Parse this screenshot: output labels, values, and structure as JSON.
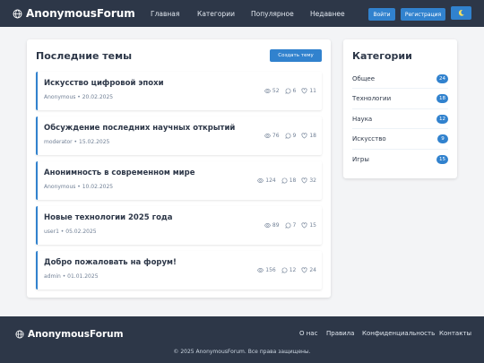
{
  "header": {
    "logo_text": "AnonymousForum",
    "nav": [
      "Главная",
      "Категории",
      "Популярное",
      "Недавнее"
    ],
    "login_label": "Войти",
    "register_label": "Регистрация",
    "theme_icon": "moon-icon"
  },
  "topics": {
    "title": "Последние темы",
    "create_label": "Создать тему",
    "items": [
      {
        "title": "Искусство цифровой эпохи",
        "meta": "Anonymous • 20.02.2025",
        "views": "52",
        "replies": "6",
        "likes": "11"
      },
      {
        "title": "Обсуждение последних научных открытий",
        "meta": "moderator • 15.02.2025",
        "views": "76",
        "replies": "9",
        "likes": "18"
      },
      {
        "title": "Анонимность в современном мире",
        "meta": "Anonymous • 10.02.2025",
        "views": "124",
        "replies": "18",
        "likes": "32"
      },
      {
        "title": "Новые технологии 2025 года",
        "meta": "user1 • 05.02.2025",
        "views": "89",
        "replies": "7",
        "likes": "15"
      },
      {
        "title": "Добро пожаловать на форум!",
        "meta": "admin • 01.01.2025",
        "views": "156",
        "replies": "12",
        "likes": "24"
      }
    ]
  },
  "categories": {
    "title": "Категории",
    "items": [
      {
        "name": "Общее",
        "count": "24"
      },
      {
        "name": "Технологии",
        "count": "18"
      },
      {
        "name": "Наука",
        "count": "12"
      },
      {
        "name": "Искусство",
        "count": "9"
      },
      {
        "name": "Игры",
        "count": "15"
      }
    ]
  },
  "footer": {
    "logo_text": "AnonymousForum",
    "links": [
      "О нас",
      "Правила",
      "Конфиденциальность",
      "Контакты"
    ],
    "copyright": "© 2025 AnonymousForum. Все права защищены."
  },
  "colors": {
    "header_bg": "#2d3748",
    "accent": "#3182ce",
    "page_bg": "#f3f4f6"
  }
}
